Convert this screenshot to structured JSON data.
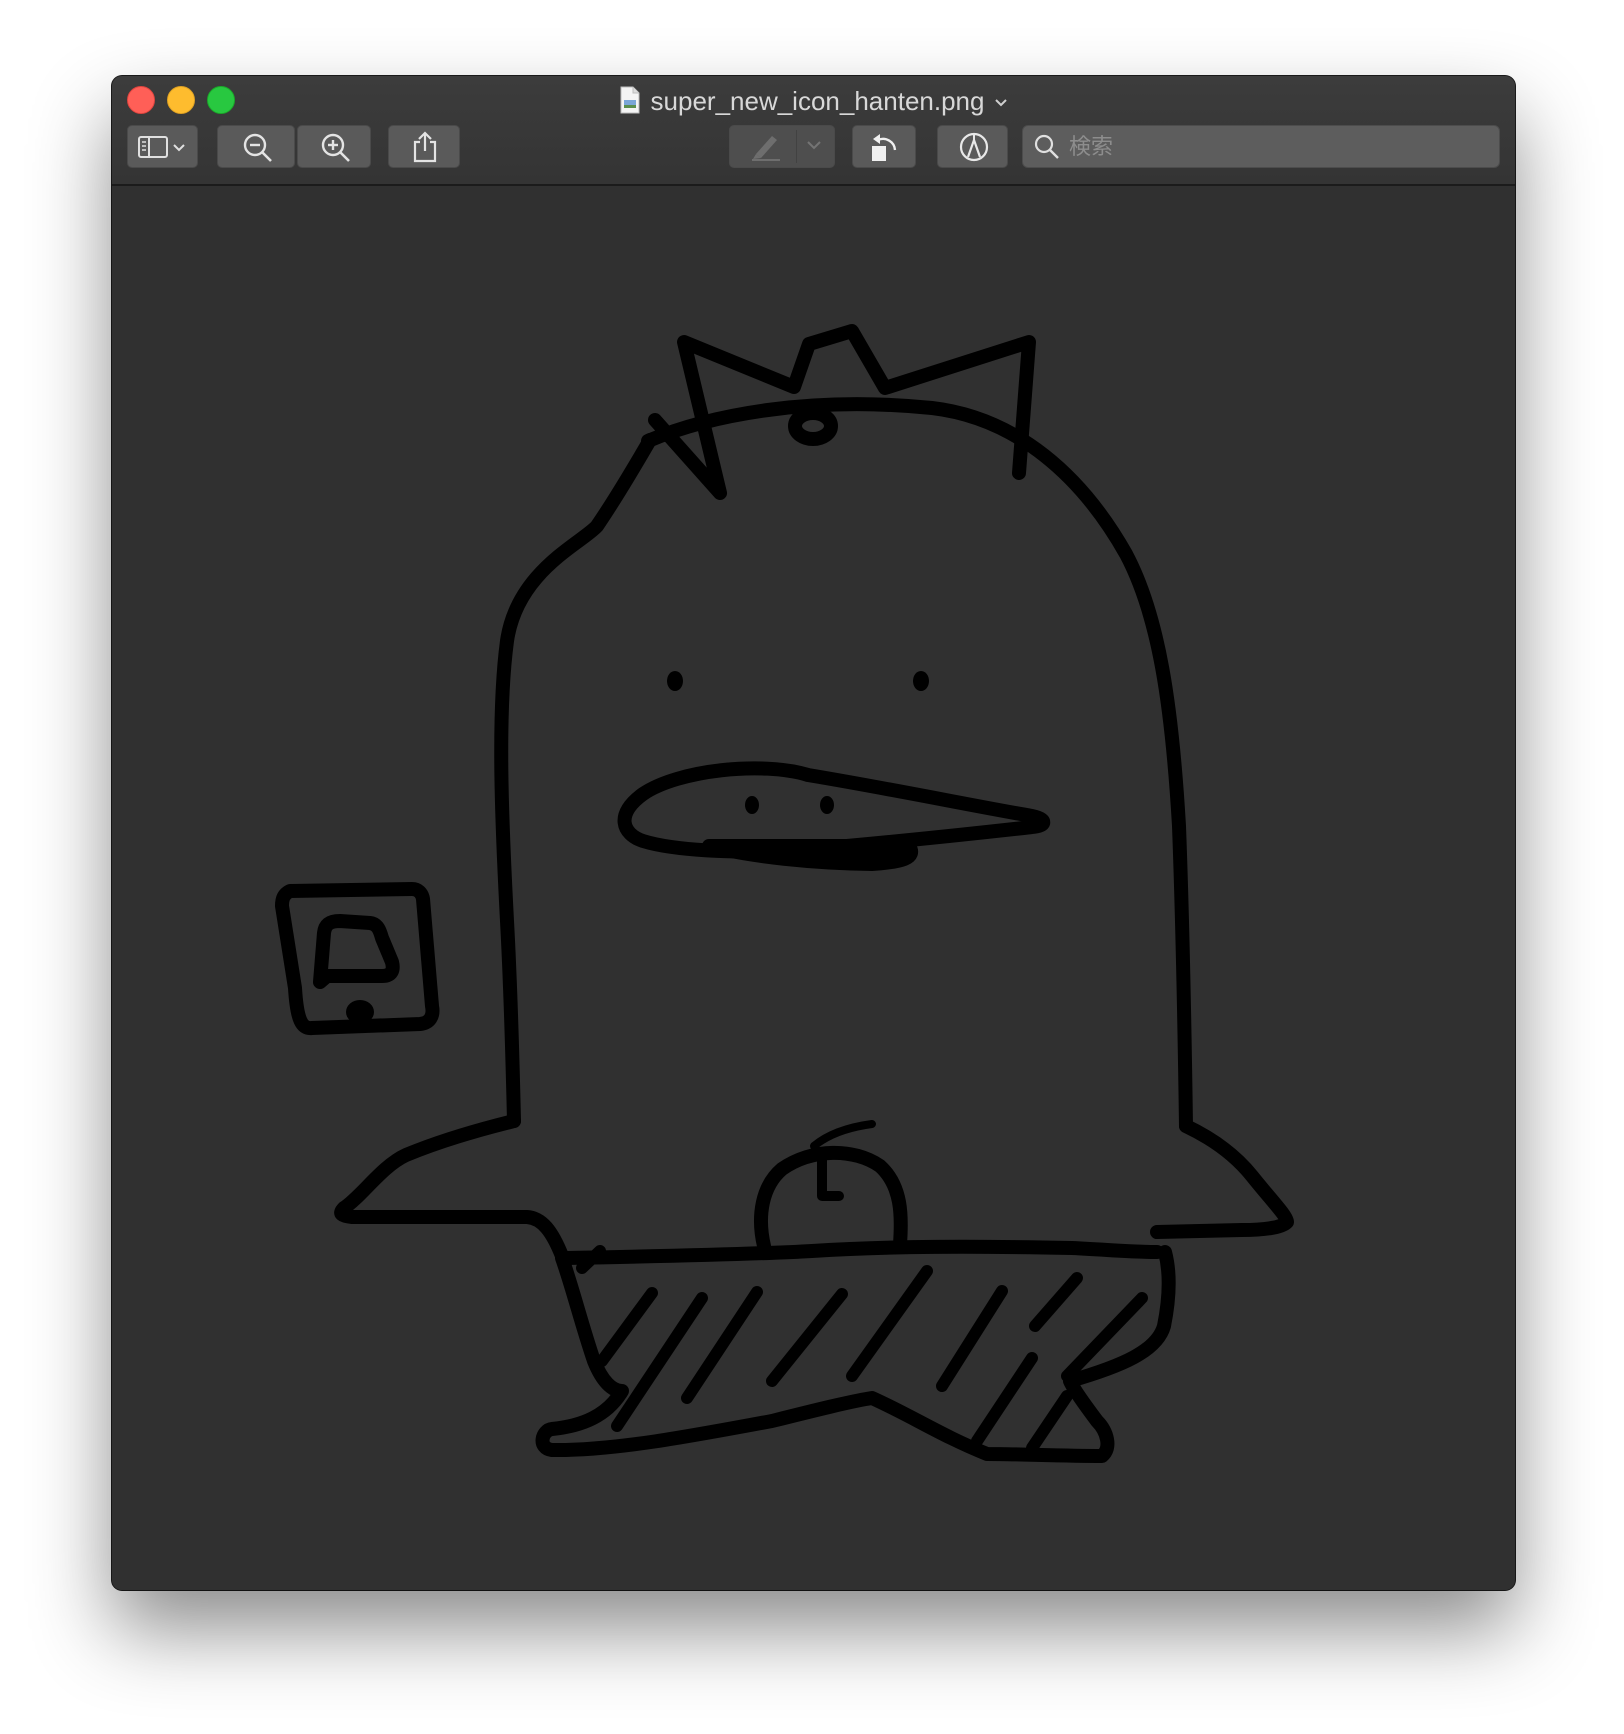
{
  "window": {
    "title": "super_new_icon_hanten.png",
    "title_icons": {
      "file": "png-file-icon",
      "chevron": "chevron-down-icon"
    }
  },
  "toolbar": {
    "buttons": [
      {
        "icon": "sidebar-toggle-icon",
        "name": "sidebar-view-button"
      },
      {
        "icon": "zoom-out-icon",
        "name": "zoom-out-button"
      },
      {
        "icon": "zoom-in-icon",
        "name": "zoom-in-button"
      },
      {
        "icon": "share-icon",
        "name": "share-button"
      },
      {
        "icon": "highlight-pen-icon",
        "name": "highlight-button"
      },
      {
        "icon": "rotate-left-icon",
        "name": "rotate-button"
      },
      {
        "icon": "markup-icon",
        "name": "markup-button"
      }
    ]
  },
  "search": {
    "placeholder": "検索",
    "icon": "search-icon"
  },
  "colors": {
    "window_bg": "#303030",
    "toolbar_button": "#5a5a5a",
    "close": "#ff5f57",
    "minimize": "#febc2e",
    "maximize": "#28c840",
    "drawing_stroke": "#000000"
  },
  "image": {
    "subject": "hand-drawn-character-drawing"
  }
}
